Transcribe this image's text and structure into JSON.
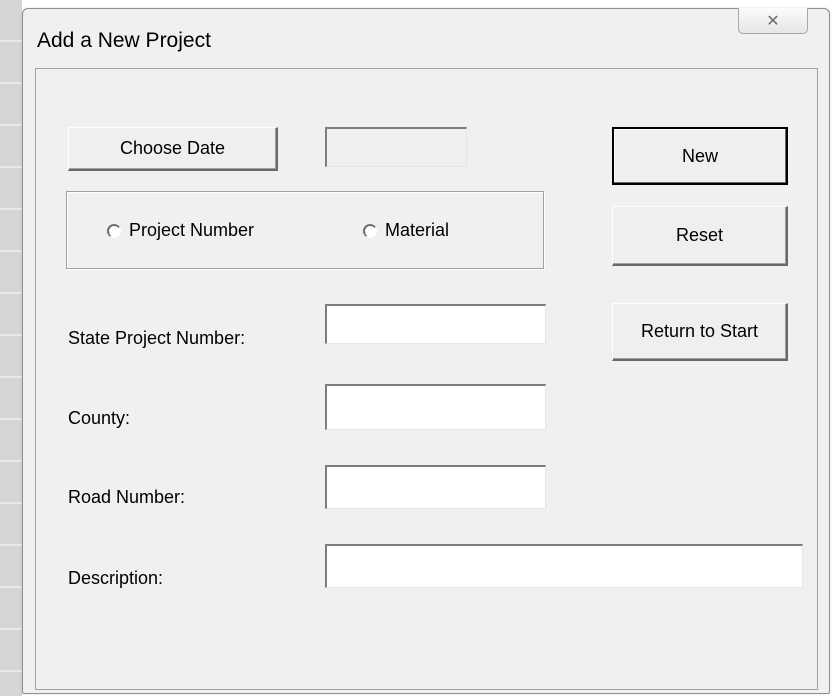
{
  "window": {
    "title": "Add a New Project",
    "close_glyph": "✕"
  },
  "buttons": {
    "choose_date": "Choose Date",
    "new": "New",
    "reset": "Reset",
    "return_to_start": "Return to Start"
  },
  "date_display": {
    "value": ""
  },
  "search_by": {
    "options": [
      "Project Number",
      "Material"
    ],
    "selected": null
  },
  "fields": {
    "state_project_number": {
      "label": "State Project Number:",
      "value": ""
    },
    "county": {
      "label": "County:",
      "value": ""
    },
    "road_number": {
      "label": "Road Number:",
      "value": ""
    },
    "description": {
      "label": "Description:",
      "value": ""
    }
  },
  "icons": {
    "close": "close-icon"
  }
}
